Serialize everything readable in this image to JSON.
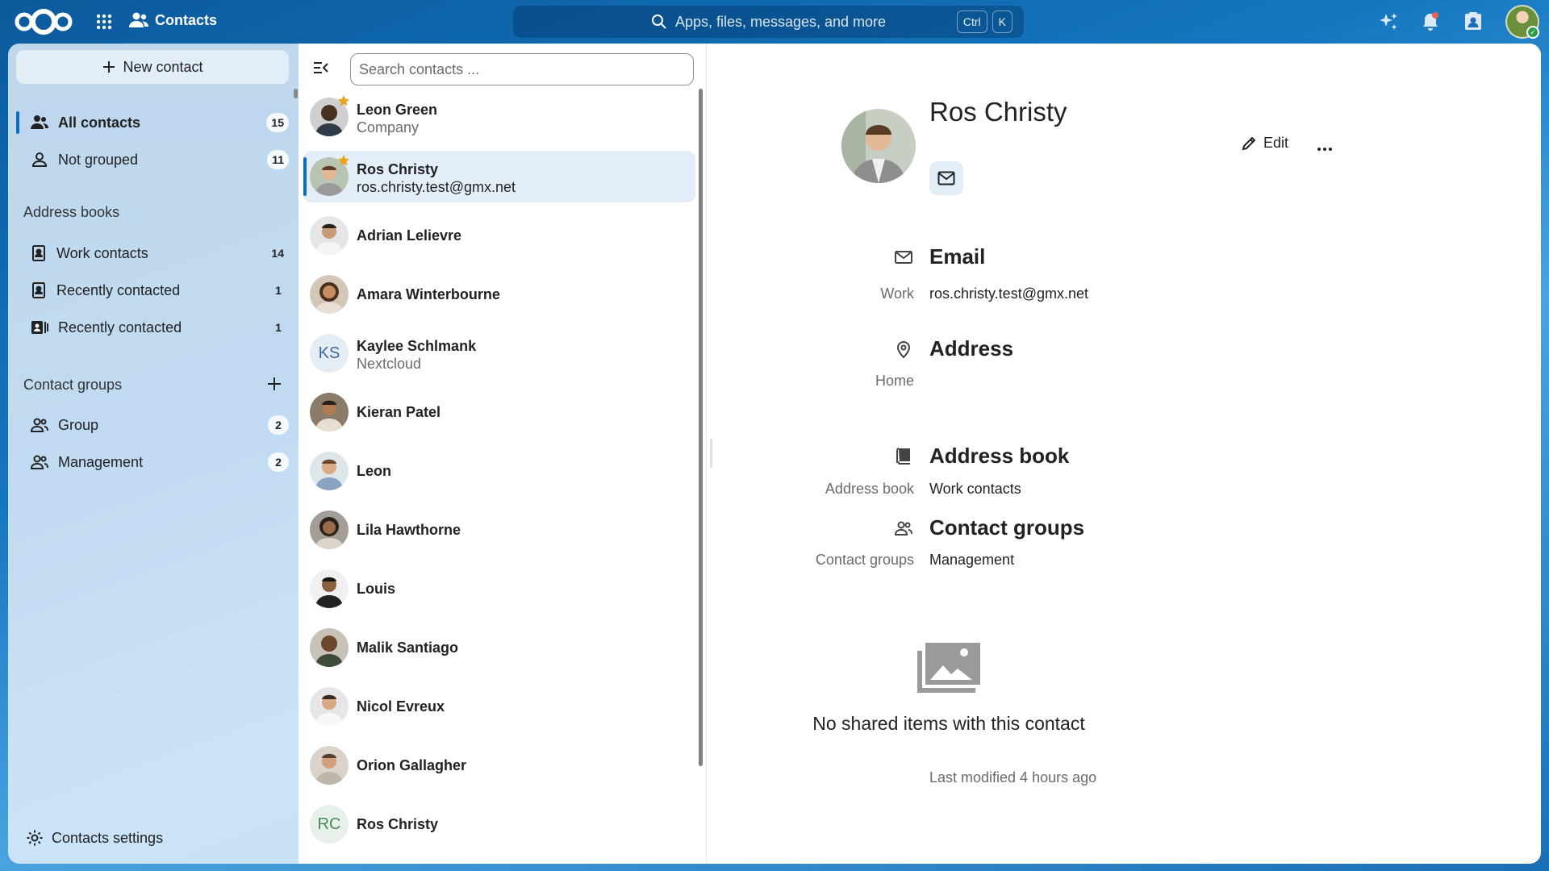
{
  "topbar": {
    "app_name": "Contacts",
    "search_placeholder": "Apps, files, messages, and more",
    "shortcut_ctrl": "Ctrl",
    "shortcut_key": "K"
  },
  "nav": {
    "new_contact": "New contact",
    "all_contacts": {
      "label": "All contacts",
      "count": "15"
    },
    "not_grouped": {
      "label": "Not grouped",
      "count": "11"
    },
    "address_books_heading": "Address books",
    "address_books": [
      {
        "label": "Work contacts",
        "count": "14"
      },
      {
        "label": "Recently contacted",
        "count": "1"
      },
      {
        "label": "Recently contacted",
        "count": "1"
      }
    ],
    "contact_groups_heading": "Contact groups",
    "groups": [
      {
        "label": "Group",
        "count": "2"
      },
      {
        "label": "Management",
        "count": "2"
      }
    ],
    "settings": "Contacts settings"
  },
  "list": {
    "search_placeholder": "Search contacts ...",
    "contacts": [
      {
        "name": "Leon Green",
        "sub": "Company",
        "favorite": true
      },
      {
        "name": "Ros Christy",
        "sub": "ros.christy.test@gmx.net",
        "favorite": true,
        "selected": true
      },
      {
        "name": "Adrian Lelievre",
        "sub": ""
      },
      {
        "name": "Amara Winterbourne",
        "sub": ""
      },
      {
        "name": "Kaylee Schlmank",
        "sub": "Nextcloud",
        "initials": "KS"
      },
      {
        "name": "Kieran Patel",
        "sub": ""
      },
      {
        "name": "Leon",
        "sub": ""
      },
      {
        "name": "Lila Hawthorne",
        "sub": ""
      },
      {
        "name": "Louis",
        "sub": ""
      },
      {
        "name": "Malik Santiago",
        "sub": ""
      },
      {
        "name": "Nicol Evreux",
        "sub": ""
      },
      {
        "name": "Orion Gallagher",
        "sub": ""
      },
      {
        "name": "Ros Christy",
        "sub": "",
        "initials": "RC"
      }
    ]
  },
  "details": {
    "name": "Ros Christy",
    "edit": "Edit",
    "email_title": "Email",
    "email_label": "Work",
    "email_value": "ros.christy.test@gmx.net",
    "address_title": "Address",
    "address_label": "Home",
    "addressbook_title": "Address book",
    "addressbook_label": "Address book",
    "addressbook_value": "Work contacts",
    "groups_title": "Contact groups",
    "groups_label": "Contact groups",
    "groups_value": "Management",
    "empty_text": "No shared items with this contact",
    "modified": "Last modified 4 hours ago"
  },
  "colors": {
    "brand": "#0a6dbf",
    "selected_bg": "#e3eef8",
    "favorite_star": "#e5a521"
  },
  "icons": [
    "nextcloud-logo",
    "apps-grid-icon",
    "contacts-icon",
    "search-icon",
    "assistant-icon",
    "bell-icon",
    "contacts-menu-icon",
    "plus-icon",
    "people-icon",
    "person-icon",
    "addressbook-icon",
    "settings-icon",
    "sidebar-toggle-icon",
    "star-icon",
    "mail-icon",
    "pencil-icon",
    "more-icon",
    "map-marker-icon",
    "book-icon",
    "folder-image-icon"
  ]
}
